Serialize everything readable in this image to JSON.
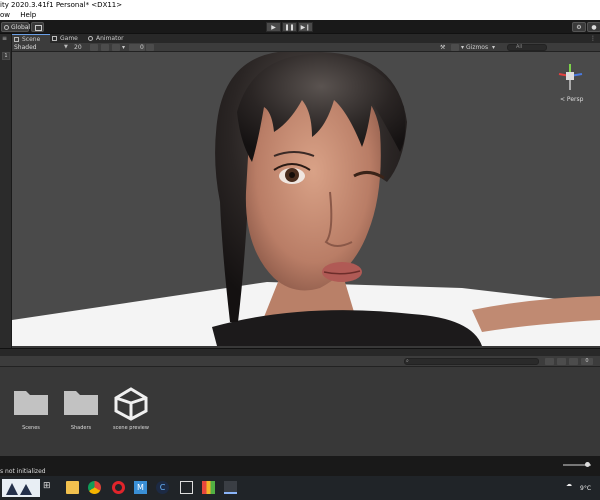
{
  "window": {
    "title": "ity 2020.3.41f1 Personal* <DX11>"
  },
  "menu": {
    "items": [
      "ow",
      "Help"
    ]
  },
  "toolbar": {
    "global_label": "Global",
    "play_icon": "play-icon",
    "pause_icon": "pause-icon",
    "step_icon": "step-icon"
  },
  "left_panel": {
    "tab_label": "",
    "toggle_label": "1"
  },
  "tabs": [
    {
      "label": "Scene",
      "active": true
    },
    {
      "label": "Game",
      "active": false
    },
    {
      "label": "Animator",
      "active": false
    }
  ],
  "scene_toolbar": {
    "shading_mode": "Shaded",
    "mode_2d": "20",
    "gizmos_label": "Gizmos",
    "search_placeholder": "All",
    "hidden_count": "0"
  },
  "viewport": {
    "projection_label": "< Persp",
    "background_color": "#4a4a4a"
  },
  "project_assets": [
    {
      "name": "Scenes",
      "type": "folder"
    },
    {
      "name": "Shaders",
      "type": "folder"
    },
    {
      "name": "scene preview",
      "type": "unity-scene"
    }
  ],
  "project_toolbar": {
    "hidden_count": "0"
  },
  "status": {
    "message": "s not initialized"
  },
  "taskbar": {
    "weather": "9°C",
    "tray_letter": "C"
  },
  "colors": {
    "accent": "#6aa0e8",
    "editor_bg": "#383838",
    "toolbar_bg": "#191919"
  }
}
